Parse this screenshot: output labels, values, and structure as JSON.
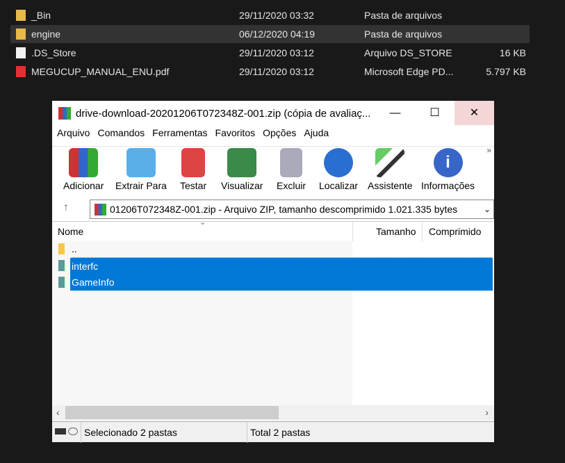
{
  "explorer": {
    "rows": [
      {
        "name": "_Bin",
        "date": "29/11/2020 03:32",
        "type": "Pasta de arquivos",
        "size": "",
        "icon": "folder-icon"
      },
      {
        "name": "engine",
        "date": "06/12/2020 04:19",
        "type": "Pasta de arquivos",
        "size": "",
        "icon": "folder-icon"
      },
      {
        "name": ".DS_Store",
        "date": "29/11/2020 03:12",
        "type": "Arquivo DS_STORE",
        "size": "16 KB",
        "icon": "file-icon"
      },
      {
        "name": "MEGUCUP_MANUAL_ENU.pdf",
        "date": "29/11/2020 03:12",
        "type": "Microsoft Edge PD...",
        "size": "5.797 KB",
        "icon": "pdf-icon"
      }
    ]
  },
  "window": {
    "title": "drive-download-20201206T072348Z-001.zip (cópia de avaliaç...",
    "menu": [
      "Arquivo",
      "Comandos",
      "Ferramentas",
      "Favoritos",
      "Opções",
      "Ajuda"
    ],
    "toolbar": [
      "Adicionar",
      "Extrair Para",
      "Testar",
      "Visualizar",
      "Excluir",
      "Localizar",
      "Assistente",
      "Informações"
    ],
    "address": "01206T072348Z-001.zip - Arquivo ZIP, tamanho descomprimido 1.021.335 bytes",
    "columns": [
      "Nome",
      "Tamanho",
      "Comprimido"
    ],
    "files": [
      {
        "name": ".."
      },
      {
        "name": "interfc"
      },
      {
        "name": "GameInfo"
      }
    ],
    "status_left": "Selecionado 2 pastas",
    "status_right": "Total 2 pastas"
  },
  "colors": {
    "selection": "#0078d7",
    "close_hover": "#f4d6d6"
  }
}
